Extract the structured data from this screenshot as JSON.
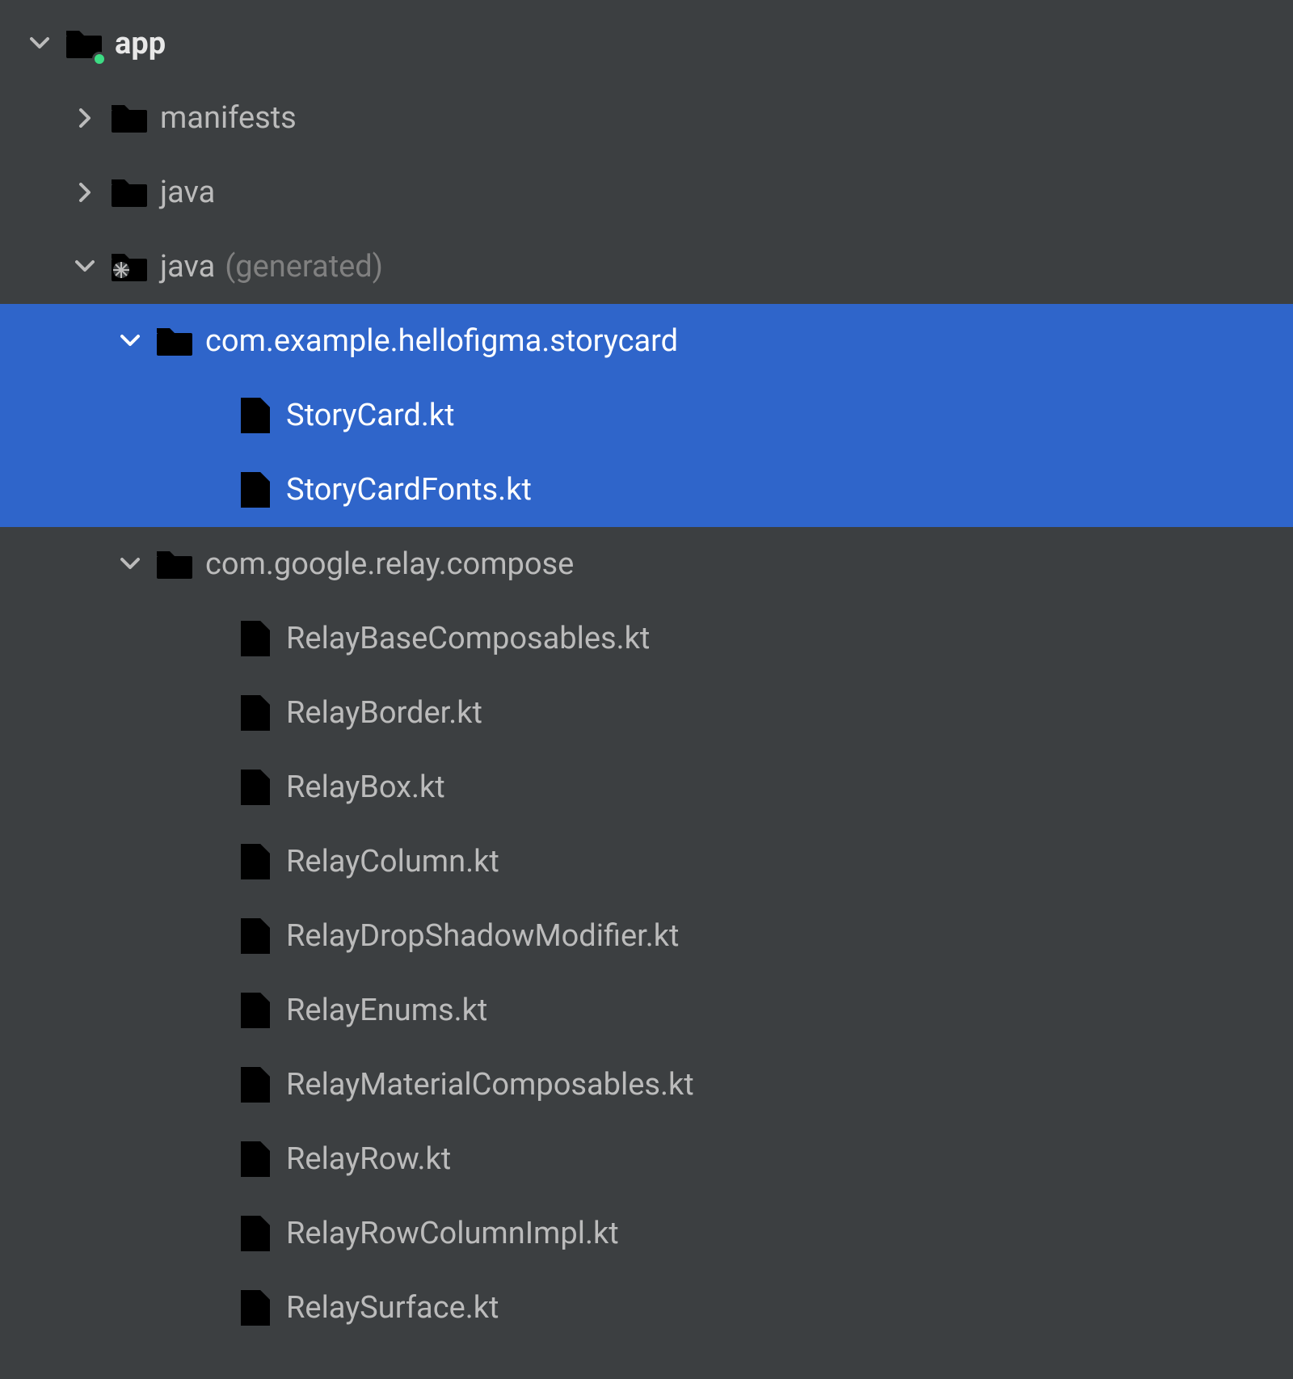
{
  "tree": {
    "root": {
      "label": "app",
      "children": {
        "manifests": {
          "label": "manifests"
        },
        "java": {
          "label": "java"
        },
        "java_gen": {
          "label": "java",
          "suffix": "(generated)",
          "packages": {
            "storycard": {
              "label": "com.example.hellofigma.storycard",
              "files": [
                {
                  "label": "StoryCard.kt"
                },
                {
                  "label": "StoryCardFonts.kt"
                }
              ]
            },
            "relay": {
              "label": "com.google.relay.compose",
              "files": [
                {
                  "label": "RelayBaseComposables.kt"
                },
                {
                  "label": "RelayBorder.kt"
                },
                {
                  "label": "RelayBox.kt"
                },
                {
                  "label": "RelayColumn.kt"
                },
                {
                  "label": "RelayDropShadowModifier.kt"
                },
                {
                  "label": "RelayEnums.kt"
                },
                {
                  "label": "RelayMaterialComposables.kt"
                },
                {
                  "label": "RelayRow.kt"
                },
                {
                  "label": "RelayRowColumnImpl.kt"
                },
                {
                  "label": "RelaySurface.kt"
                }
              ]
            }
          }
        }
      }
    }
  }
}
